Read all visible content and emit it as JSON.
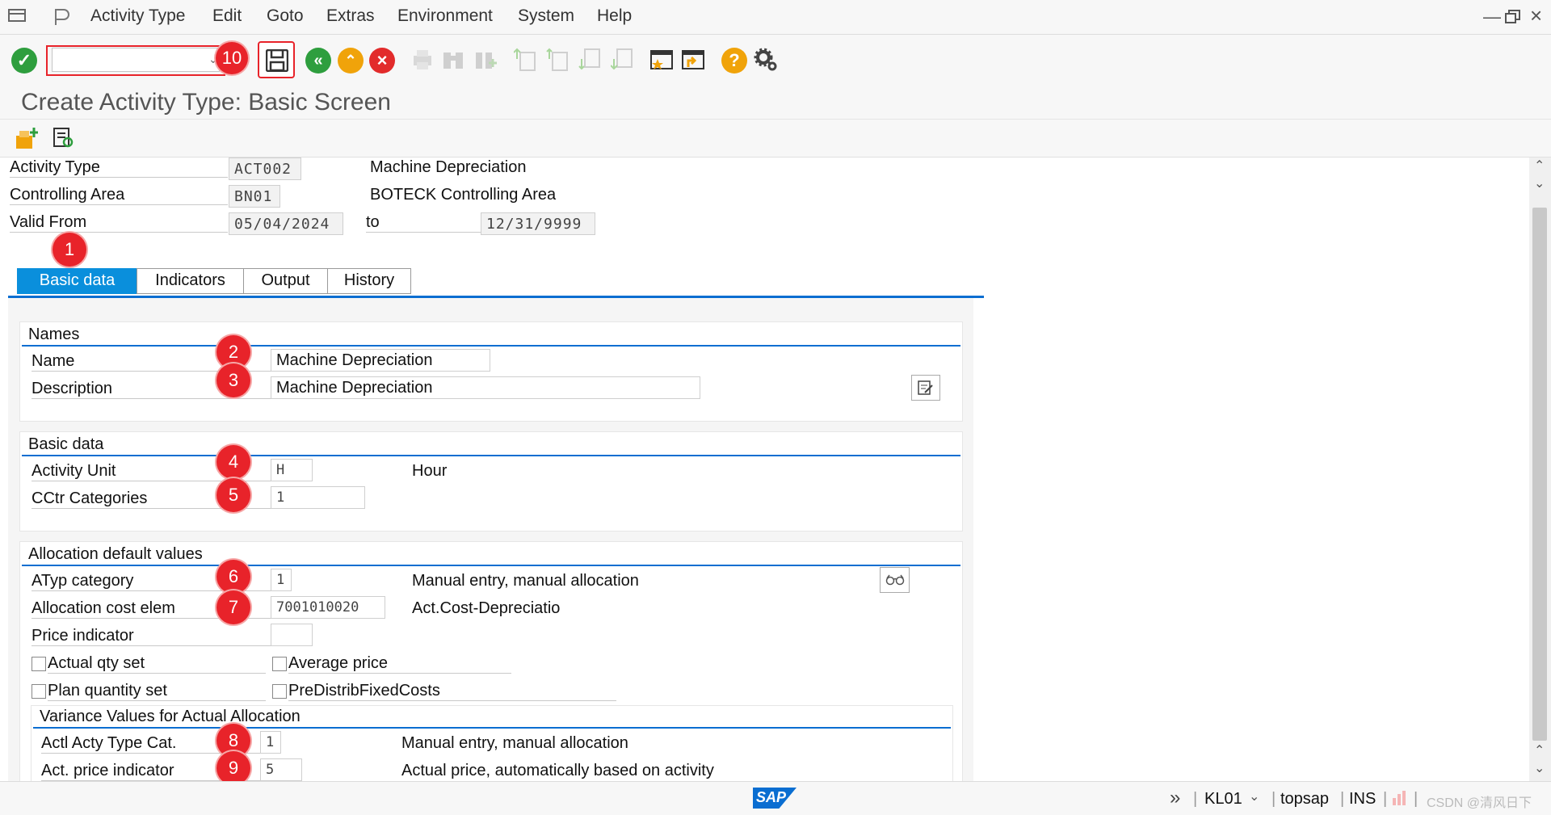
{
  "menubar": {
    "items": [
      "Activity Type",
      "Edit",
      "Goto",
      "Extras",
      "Environment",
      "System",
      "Help"
    ]
  },
  "toolbar": {
    "command_field_value": "",
    "badge_save": "10"
  },
  "title": "Create Activity Type: Basic Screen",
  "header": {
    "activity_type_label": "Activity Type",
    "activity_type_value": "ACT002",
    "activity_type_text": "Machine Depreciation",
    "controlling_area_label": "Controlling Area",
    "controlling_area_value": "BN01",
    "controlling_area_text": "BOTECK Controlling Area",
    "valid_from_label": "Valid From",
    "valid_from_value": "05/04/2024",
    "to_label": "to",
    "valid_to_value": "12/31/9999"
  },
  "tabs": [
    {
      "label": "Basic data",
      "active": true
    },
    {
      "label": "Indicators",
      "active": false
    },
    {
      "label": "Output",
      "active": false
    },
    {
      "label": "History",
      "active": false
    }
  ],
  "badges": [
    "1",
    "2",
    "3",
    "4",
    "5",
    "6",
    "7",
    "8",
    "9"
  ],
  "names": {
    "title": "Names",
    "name_label": "Name",
    "name_value": "Machine Depreciation",
    "description_label": "Description",
    "description_value": "Machine Depreciation"
  },
  "basic_data": {
    "title": "Basic data",
    "activity_unit_label": "Activity Unit",
    "activity_unit_value": "H",
    "activity_unit_text": "Hour",
    "cctr_categories_label": "CCtr Categories",
    "cctr_categories_value": "1"
  },
  "allocation": {
    "title": "Allocation default values",
    "atyp_category_label": "ATyp category",
    "atyp_category_value": "1",
    "atyp_category_text": "Manual entry, manual allocation",
    "alloc_cost_elem_label": "Allocation cost elem",
    "alloc_cost_elem_value": "7001010020",
    "alloc_cost_elem_text": "Act.Cost-Depreciatio",
    "price_indicator_label": "Price indicator",
    "price_indicator_value": "",
    "actual_qty_set_label": "Actual qty set",
    "average_price_label": "Average price",
    "plan_quantity_set_label": "Plan quantity set",
    "predistrib_fixed_costs_label": "PreDistribFixedCosts"
  },
  "variance": {
    "title": "Variance Values for Actual Allocation",
    "actl_acty_type_cat_label": "Actl Acty Type Cat.",
    "actl_acty_type_cat_value": "1",
    "actl_acty_type_cat_text": "Manual entry, manual allocation",
    "act_price_indicator_label": "Act. price indicator",
    "act_price_indicator_value": "5",
    "act_price_indicator_text": "Actual price, automatically based on activity"
  },
  "statusbar": {
    "logo": "SAP",
    "system": "KL01",
    "server": "topsap",
    "mode": "INS",
    "watermark": "CSDN @清风日下"
  },
  "colors": {
    "accent": "#0a6ed1",
    "tab_active": "#0a8fdc",
    "badge": "#e8232a",
    "ok_green": "#2e9e3e",
    "cancel_red": "#e22b2b",
    "warning_orange": "#f0a30a"
  }
}
